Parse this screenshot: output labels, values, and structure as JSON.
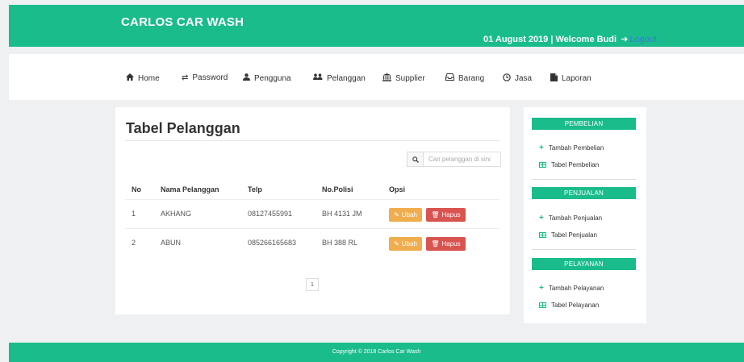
{
  "header": {
    "brand": "CARLOS CAR WASH",
    "welcome": "01 August 2019 | Welcome Budi",
    "logout": "Logout"
  },
  "nav": {
    "items": [
      {
        "label": "Home",
        "icon": "home-icon"
      },
      {
        "label": "Password",
        "icon": "exchange-icon"
      },
      {
        "label": "Pengguna",
        "icon": "user-icon"
      },
      {
        "label": "Pelanggan",
        "icon": "users-icon"
      },
      {
        "label": "Supplier",
        "icon": "bank-icon"
      },
      {
        "label": "Barang",
        "icon": "inbox-icon"
      },
      {
        "label": "Jasa",
        "icon": "clock-icon"
      },
      {
        "label": "Laporan",
        "icon": "file-icon"
      }
    ]
  },
  "main": {
    "title": "Tabel Pelanggan",
    "search_placeholder": "Cari pelanggan di sini",
    "columns": [
      "No",
      "Nama Pelanggan",
      "Telp",
      "No.Polisi",
      "Opsi"
    ],
    "rows": [
      {
        "no": "1",
        "nama": "AKHANG",
        "telp": "08127455991",
        "polisi": "BH 4131 JM"
      },
      {
        "no": "2",
        "nama": "ABUN",
        "telp": "085266165683",
        "polisi": "BH 388 RL"
      }
    ],
    "edit_label": "Ubah",
    "delete_label": "Hapus",
    "page": "1"
  },
  "sidebar": {
    "sections": [
      {
        "title": "PEMBELIAN",
        "add": "Tambah Pembelian",
        "table": "Tabel Pembelian"
      },
      {
        "title": "PENJUALAN",
        "add": "Tambah Penjualan",
        "table": "Tabel Penjualan"
      },
      {
        "title": "PELAYANAN",
        "add": "Tambah Pelayanan",
        "table": "Tabel Pelayanan"
      }
    ]
  },
  "footer": {
    "text": "Copyright © 2018 Carlos Car Wash"
  },
  "colors": {
    "primary": "#1abc8c",
    "edit": "#f0ad4e",
    "delete": "#d9534f",
    "link": "#3a7bd5"
  }
}
